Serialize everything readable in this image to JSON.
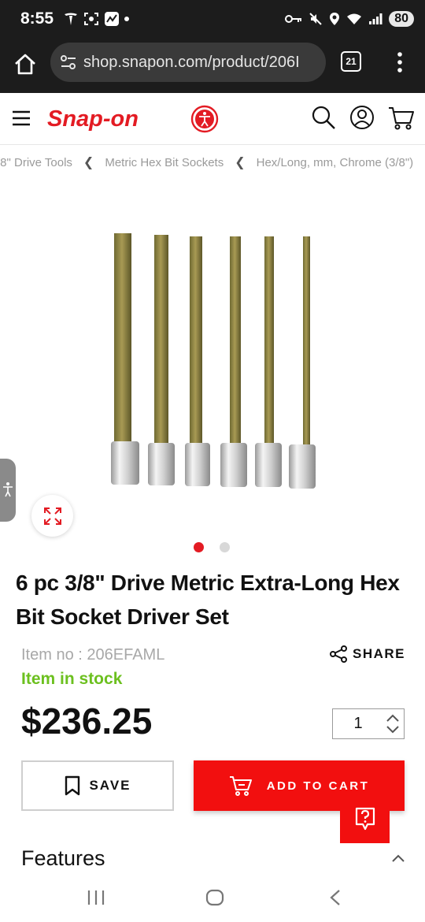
{
  "status_bar": {
    "time": "8:55",
    "battery": "80"
  },
  "browser": {
    "url": "shop.snapon.com/product/206I",
    "tab_count": "21"
  },
  "site": {
    "logo_text": "Snap-on"
  },
  "breadcrumb": [
    "/8\" Drive Tools",
    "Metric Hex Bit Sockets",
    "Hex/Long, mm, Chrome (3/8\")"
  ],
  "carousel": {
    "total": 2,
    "active_index": 0
  },
  "product": {
    "title": "6 pc 3/8\" Drive Metric Extra-Long Hex Bit Socket Driver Set",
    "item_no": "Item no : 206EFAML",
    "stock_status": "Item in stock",
    "price": "$236.25",
    "quantity": "1"
  },
  "actions": {
    "share_label": "SHARE",
    "save_label": "SAVE",
    "add_to_cart_label": "ADD TO CART"
  },
  "sections": {
    "features_label": "Features"
  },
  "colors": {
    "brand_red": "#f20f0f",
    "stock_green": "#6cc01f",
    "status_bar_bg": "#1c1c1c"
  },
  "icons": {
    "header": [
      "hamburger-menu-icon",
      "accessibility-icon",
      "search-icon",
      "account-icon",
      "cart-icon"
    ],
    "nav": [
      "recent-apps-icon",
      "home-icon",
      "back-icon"
    ]
  }
}
